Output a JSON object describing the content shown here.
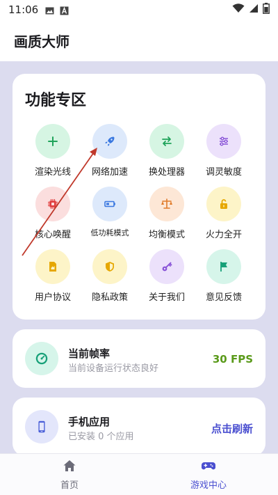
{
  "status_bar": {
    "time": "11:06"
  },
  "app": {
    "title": "画质大师"
  },
  "features": {
    "title": "功能专区",
    "items": [
      {
        "label": "渲染光线",
        "icon": "plus-icon",
        "bg": "#d6f5e3",
        "fg": "#1fa35a"
      },
      {
        "label": "网络加速",
        "icon": "rocket-icon",
        "bg": "#dde9fb",
        "fg": "#3a78e0"
      },
      {
        "label": "换处理器",
        "icon": "swap-arrows-icon",
        "bg": "#d6f5e3",
        "fg": "#1fa35a"
      },
      {
        "label": "调灵敏度",
        "icon": "sliders-icon",
        "bg": "#ece1fb",
        "fg": "#8a55d8"
      },
      {
        "label": "核心唤醒",
        "icon": "chip-icon",
        "bg": "#fbdede",
        "fg": "#e03d3d"
      },
      {
        "label": "低功耗模式",
        "icon": "battery-icon",
        "bg": "#dde9fb",
        "fg": "#3a78e0"
      },
      {
        "label": "均衡模式",
        "icon": "balance-scale-icon",
        "bg": "#fde7d6",
        "fg": "#e07b2a"
      },
      {
        "label": "火力全开",
        "icon": "unlock-icon",
        "bg": "#fdf4c8",
        "fg": "#e6a700"
      },
      {
        "label": "用户协议",
        "icon": "document-icon",
        "bg": "#fdf4c8",
        "fg": "#e6a700"
      },
      {
        "label": "隐私政策",
        "icon": "shield-icon",
        "bg": "#fdf4c8",
        "fg": "#e6a700"
      },
      {
        "label": "关于我们",
        "icon": "key-icon",
        "bg": "#ece1fb",
        "fg": "#8a55d8"
      },
      {
        "label": "意见反馈",
        "icon": "flag-icon",
        "bg": "#d6f5ea",
        "fg": "#17a078"
      }
    ]
  },
  "fps_card": {
    "title": "当前帧率",
    "subtitle": "当前设备运行状态良好",
    "value": "30 FPS",
    "value_color": "#5a9a1a",
    "icon": "speedometer-icon"
  },
  "apps_card": {
    "title": "手机应用",
    "subtitle": "已安装 0 个应用",
    "action": "点击刷新",
    "action_color": "#4a4fd0",
    "icon": "phone-icon"
  },
  "bottom_nav": {
    "items": [
      {
        "label": "首页",
        "icon": "home-icon",
        "active": false
      },
      {
        "label": "游戏中心",
        "icon": "gamepad-icon",
        "active": true
      }
    ]
  },
  "colors": {
    "background": "#dcdcef",
    "active_nav": "#4a4fd0",
    "inactive_nav": "#6b6b78",
    "annotation_arrow": "#c0392b"
  }
}
